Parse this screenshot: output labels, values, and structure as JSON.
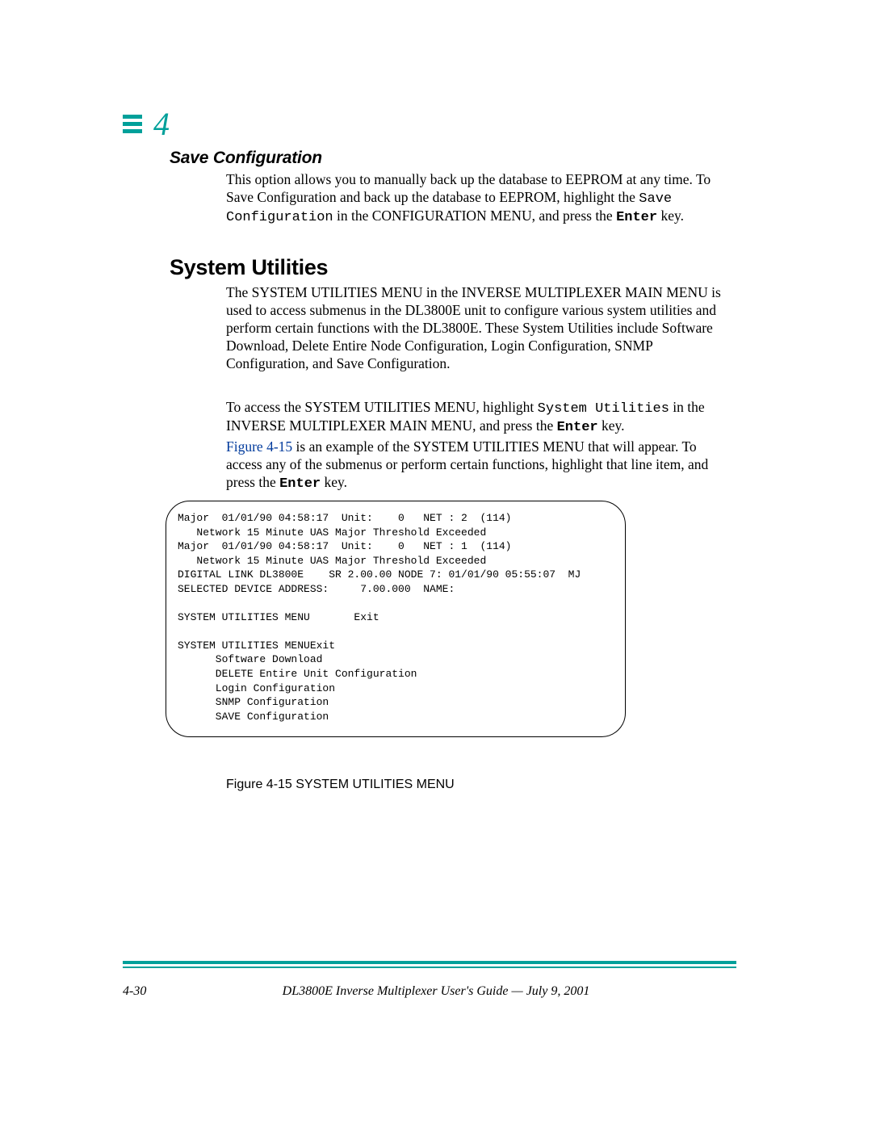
{
  "chapter": {
    "number": "4"
  },
  "section_save": {
    "title": "Save Configuration",
    "para": "This option allows you to manually back up the database to EEPROM at any time. To Save Configuration and back up the database to EEPROM, highlight the ",
    "code1": "Save Configuration",
    "para_cont": " in the CONFIGURATION MENU, and press the ",
    "enter": "Enter",
    "tail": " key."
  },
  "section_sysutil": {
    "title": "System Utilities",
    "para1": "The SYSTEM UTILITIES MENU in the INVERSE MULTIPLEXER MAIN MENU is used to access submenus in the DL3800E unit to configure various system utilities and perform certain functions with the DL3800E. These System Utilities include Software Download, Delete Entire Node Configuration, Login Configuration, SNMP Configuration, and Save Configuration.",
    "para2_a": "To access the SYSTEM UTILITIES MENU, highlight ",
    "code2": "System Utilities",
    "para2_b": " in the INVERSE MULTIPLEXER MAIN MENU, and press the ",
    "enter2": "Enter",
    "para2_c": " key.",
    "para3_link": "Figure 4-15",
    "para3_rest": " is an example of the SYSTEM UTILITIES MENU that will appear. To access any of the submenus or perform certain functions, highlight that line item, and press the ",
    "enter3": "Enter",
    "para3_tail": " key."
  },
  "terminal": "Major  01/01/90 04:58:17  Unit:    0   NET : 2  (114)\n   Network 15 Minute UAS Major Threshold Exceeded\nMajor  01/01/90 04:58:17  Unit:    0   NET : 1  (114)\n   Network 15 Minute UAS Major Threshold Exceeded\nDIGITAL LINK DL3800E    SR 2.00.00 NODE 7: 01/01/90 05:55:07  MJ\nSELECTED DEVICE ADDRESS:     7.00.000  NAME:\n\nSYSTEM UTILITIES MENU       Exit\n\nSYSTEM UTILITIES MENUExit\n      Software Download\n      DELETE Entire Unit Configuration\n      Login Configuration\n      SNMP Configuration\n      SAVE Configuration",
  "figure_caption": "Figure 4-15  SYSTEM UTILITIES MENU",
  "footer": {
    "page": "4-30",
    "title": "DL3800E Inverse Multiplexer User's Guide — July 9, 2001"
  }
}
